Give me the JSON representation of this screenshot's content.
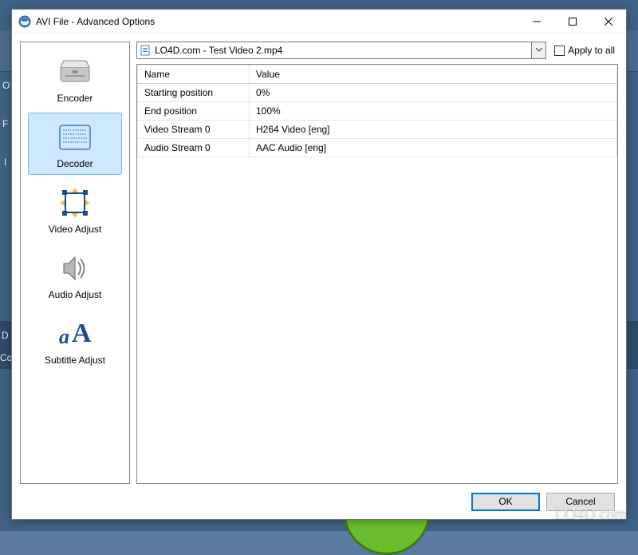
{
  "window": {
    "title": "AVI File - Advanced Options"
  },
  "sidebar": {
    "items": [
      {
        "label": "Encoder"
      },
      {
        "label": "Decoder"
      },
      {
        "label": "Video Adjust"
      },
      {
        "label": "Audio Adjust"
      },
      {
        "label": "Subtitle Adjust"
      }
    ]
  },
  "file_selector": {
    "selected": "LO4D.com - Test Video 2.mp4"
  },
  "apply_all": {
    "label": "Apply to all",
    "checked": false
  },
  "table": {
    "headers": {
      "name": "Name",
      "value": "Value"
    },
    "rows": [
      {
        "name": "Starting position",
        "value": "0%"
      },
      {
        "name": "End position",
        "value": "100%"
      },
      {
        "name": "Video Stream 0",
        "value": "H264 Video [eng]"
      },
      {
        "name": "Audio Stream 0",
        "value": "AAC Audio [eng]"
      }
    ]
  },
  "buttons": {
    "ok": "OK",
    "cancel": "Cancel"
  },
  "watermark": "LO4D.com",
  "bg": {
    "t1": "O",
    "t2": "F",
    "t3": "I",
    "t4": "D",
    "t5": "Co"
  }
}
